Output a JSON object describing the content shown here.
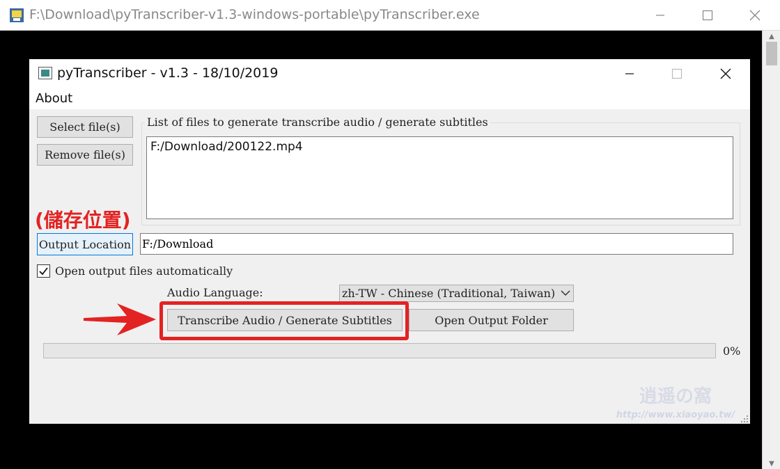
{
  "outer_window": {
    "title": "F:\\Download\\pyTranscriber-v1.3-windows-portable\\pyTranscriber.exe",
    "controls": [
      "minimize",
      "maximize",
      "close"
    ]
  },
  "app_window": {
    "title": "pyTranscriber - v1.3 - 18/10/2019",
    "menu": [
      "About"
    ]
  },
  "buttons": {
    "select_files": "Select file(s)",
    "remove_files": "Remove file(s)",
    "output_location": "Output Location",
    "transcribe": "Transcribe Audio / Generate Subtitles",
    "open_output_folder": "Open Output Folder"
  },
  "file_list": {
    "group_label": "List of files to generate transcribe audio / generate subtitles",
    "items": [
      "F:/Download/200122.mp4"
    ]
  },
  "annotation": {
    "storage_label": "(儲存位置)",
    "highlight_color": "#e32222"
  },
  "output_path": "F:/Download",
  "open_automatically": {
    "label": "Open output files automatically",
    "checked": true
  },
  "audio_language": {
    "label": "Audio Language:",
    "selected": "zh-TW - Chinese (Traditional, Taiwan)"
  },
  "progress": {
    "value": 0,
    "label": "0%"
  },
  "watermark": {
    "text": "http://www.xiaoyao.tw/"
  },
  "icons": [
    "app-icon",
    "minimize-icon",
    "maximize-icon",
    "close-icon",
    "checkmark-icon",
    "chevron-down-icon",
    "red-arrow-icon",
    "resize-grip-icon"
  ]
}
